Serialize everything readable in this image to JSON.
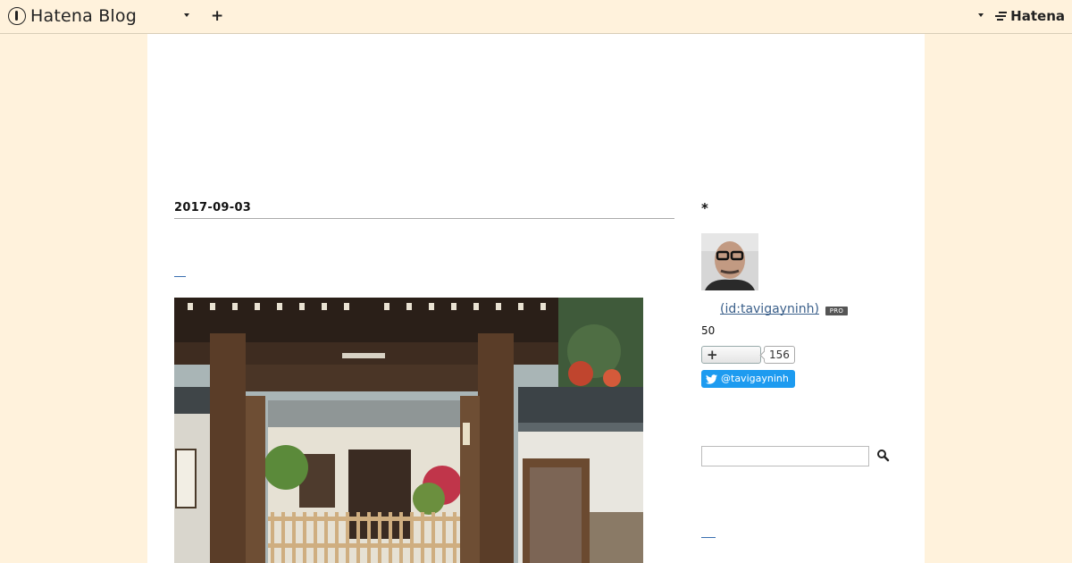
{
  "topbar": {
    "logo_text": "Hatena Blog",
    "add_label": "+",
    "hatena_label": "Hatena"
  },
  "entry": {
    "date": "2017-09-03",
    "link_text": "",
    "photo_icon": "temple-gate-photo"
  },
  "sidebar": {
    "title": "*",
    "profile_id": "(id:tavigayninh)",
    "pro_badge": "PRO",
    "followers": "50",
    "subscribe_label": "+",
    "subscribe_count": "156",
    "twitter_handle": "@tavigayninh",
    "search_placeholder": ""
  },
  "colors": {
    "background": "#fff2dc",
    "page": "#ffffff",
    "link": "#3a5f8a",
    "twitter": "#1d9bf0"
  }
}
